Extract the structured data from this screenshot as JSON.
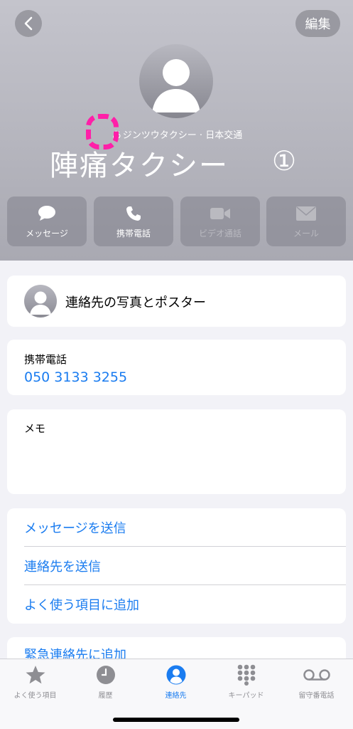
{
  "header": {
    "edit_label": "編集",
    "phonetic_kana": "あ",
    "phonetic_rest": "ジンツウタクシー · 日本交通",
    "name": "陣痛タクシー",
    "name_marker": "①"
  },
  "actions": [
    {
      "label": "メッセージ",
      "icon": "message-bubble-icon",
      "enabled": true
    },
    {
      "label": "携帯電話",
      "icon": "phone-icon",
      "enabled": true
    },
    {
      "label": "ビデオ通話",
      "icon": "video-camera-icon",
      "enabled": false
    },
    {
      "label": "メール",
      "icon": "envelope-icon",
      "enabled": false
    }
  ],
  "poster": {
    "label": "連絡先の写真とポスター"
  },
  "phone": {
    "label": "携帯電話",
    "value": "050 3133 3255"
  },
  "memo": {
    "label": "メモ"
  },
  "links": [
    {
      "label": "メッセージを送信"
    },
    {
      "label": "連絡先を送信"
    },
    {
      "label": "よく使う項目に追加"
    },
    {
      "label": "緊急連絡先に追加"
    }
  ],
  "tabs": [
    {
      "label": "よく使う項目",
      "icon": "star-icon",
      "active": false
    },
    {
      "label": "履歴",
      "icon": "clock-icon",
      "active": false
    },
    {
      "label": "連絡先",
      "icon": "person-circle-icon",
      "active": true
    },
    {
      "label": "キーパッド",
      "icon": "keypad-icon",
      "active": false
    },
    {
      "label": "留守番電話",
      "icon": "voicemail-icon",
      "active": false
    }
  ],
  "colors": {
    "accent": "#1a7cf0",
    "annotation": "#ff1fa8"
  }
}
